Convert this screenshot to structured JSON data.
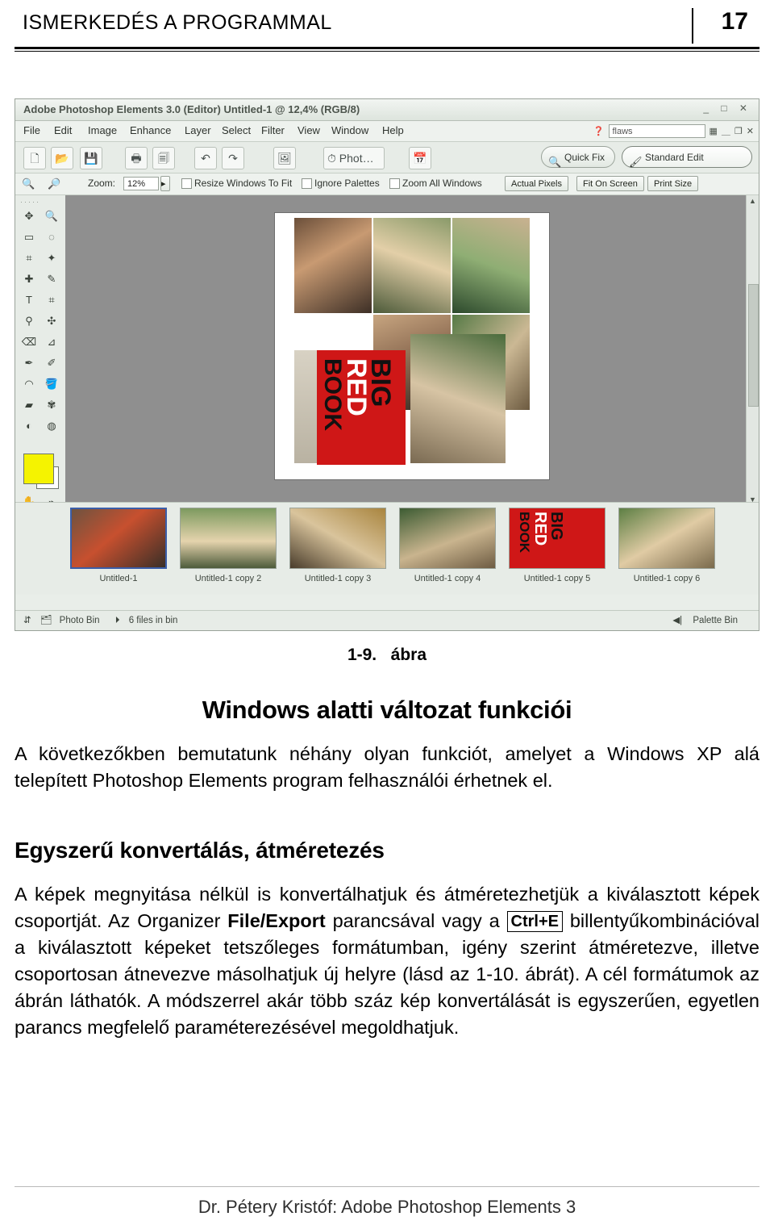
{
  "header": {
    "title": "ISMERKEDÉS A PROGRAMMAL",
    "page_number": "17"
  },
  "screenshot": {
    "window_title": "Adobe Photoshop Elements 3.0 (Editor) Untitled-1 @ 12,4% (RGB/8)",
    "window_buttons": "_ □ ✕",
    "menu": [
      "File",
      "Edit",
      "Image",
      "Enhance",
      "Layer",
      "Select",
      "Filter",
      "View",
      "Window",
      "Help"
    ],
    "search_placeholder": "flaws",
    "toolbar_buttons": [
      "Quick Fix",
      "Standard Edit"
    ],
    "options": {
      "zoom_label": "Zoom:",
      "zoom_value": "12%",
      "resize_windows": "Resize Windows To Fit",
      "ignore_palettes": "Ignore Palettes",
      "zoom_all": "Zoom All Windows",
      "actual_pixels": "Actual Pixels",
      "fit_on_screen": "Fit On Screen",
      "print_size": "Print Size"
    },
    "photo_bin": {
      "items": [
        {
          "label": "Untitled-1",
          "selected": true
        },
        {
          "label": "Untitled-1 copy 2",
          "selected": false
        },
        {
          "label": "Untitled-1 copy 3",
          "selected": false
        },
        {
          "label": "Untitled-1 copy 4",
          "selected": false
        },
        {
          "label": "Untitled-1 copy 5",
          "selected": false
        },
        {
          "label": "Untitled-1 copy 6",
          "selected": false
        }
      ]
    },
    "status": {
      "photo_bin_label": "Photo Bin",
      "files_in_bin": "6 files in bin",
      "palette_bin_label": "Palette Bin"
    },
    "book_cover": {
      "line1": "BIG",
      "line2": "RED",
      "line3": "BOOK"
    }
  },
  "figure_caption": {
    "number": "1-9.",
    "word": "ábra"
  },
  "section_title": "Windows alatti változat funkciói",
  "paragraph_1": "A következőkben bemutatunk néhány olyan funkciót, amelyet a Windows XP alá telepített Photoshop Elements program felhasználói érhetnek el.",
  "subsection_title": "Egyszerű konvertálás, átméretezés",
  "paragraph_2_a": "A képek megnyitása nélkül is konvertálhatjuk és átméretezhetjük a kiválasztott képek csoportját. Az Organizer ",
  "paragraph_2_bold": "File/Export",
  "paragraph_2_b": " parancsával vagy a ",
  "paragraph_2_key": "Ctrl+E",
  "paragraph_2_c": " billentyűkombinációval a kiválasztott képeket tetszőleges formátumban, igény szerint átméretezve, illetve csoportosan átnevezve másolhatjuk új helyre (lásd az 1-10. ábrát). A cél formátumok az ábrán láthatók. A módszerrel akár több száz kép konvertálását is egyszerűen, egyetlen parancs megfelelő paraméterezésével megoldhatjuk.",
  "footer": "Dr. Pétery Kristóf: Adobe Photoshop Elements 3"
}
